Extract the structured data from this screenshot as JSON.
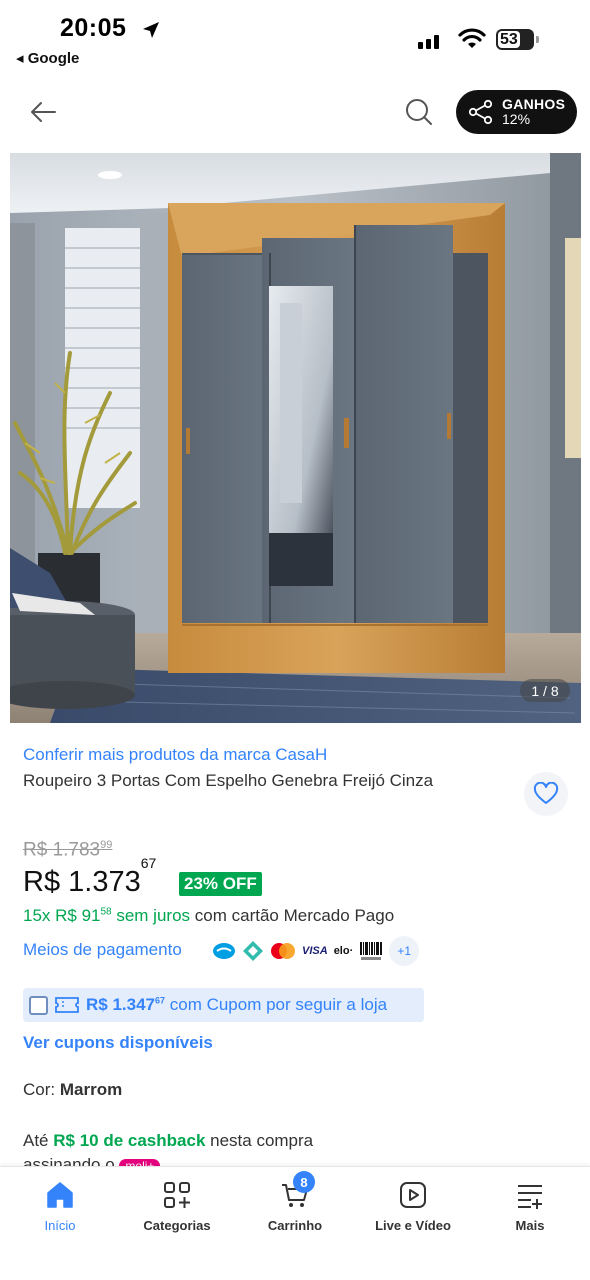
{
  "status_bar": {
    "time": "20:05",
    "back_app": "◂ Google",
    "battery": "53"
  },
  "header": {
    "share_label": "GANHOS",
    "share_percent": "12%"
  },
  "gallery": {
    "counter": "1 / 8"
  },
  "product": {
    "brand_link": "Conferir mais produtos da marca CasaH",
    "title": "Roupeiro 3 Portas Com Espelho Genebra Freijó Cinza",
    "old_price_main": "R$ 1.783",
    "old_price_cents": "99",
    "price_main": "R$ 1.373",
    "price_cents": "67",
    "discount": "23% OFF",
    "installments_prefix": "15x R$ 91",
    "installments_cents": "58",
    "installments_interest": " sem juros",
    "installments_suffix": " com cartão Mercado Pago",
    "payment_link": "Meios de pagamento",
    "payment_more": "+1",
    "coupon_price": "R$ 1.347",
    "coupon_cents": "67",
    "coupon_text": " com Cupom por seguir a loja",
    "see_coupons": "Ver cupons disponíveis",
    "color_label": "Cor: ",
    "color_value": "Marrom",
    "cashback_prefix": "Até ",
    "cashback_amount": "R$ 10 de cashback",
    "cashback_suffix": " nesta compra",
    "cashback_line2": "assinando o",
    "meli_badge": "meli+"
  },
  "tabbar": {
    "items": [
      {
        "label": "Início"
      },
      {
        "label": "Categorias"
      },
      {
        "label": "Carrinho"
      },
      {
        "label": "Live e Vídeo"
      },
      {
        "label": "Mais"
      }
    ],
    "cart_count": "8"
  },
  "colors": {
    "accent": "#3483fa",
    "green": "#00a650",
    "dark": "#111111"
  }
}
